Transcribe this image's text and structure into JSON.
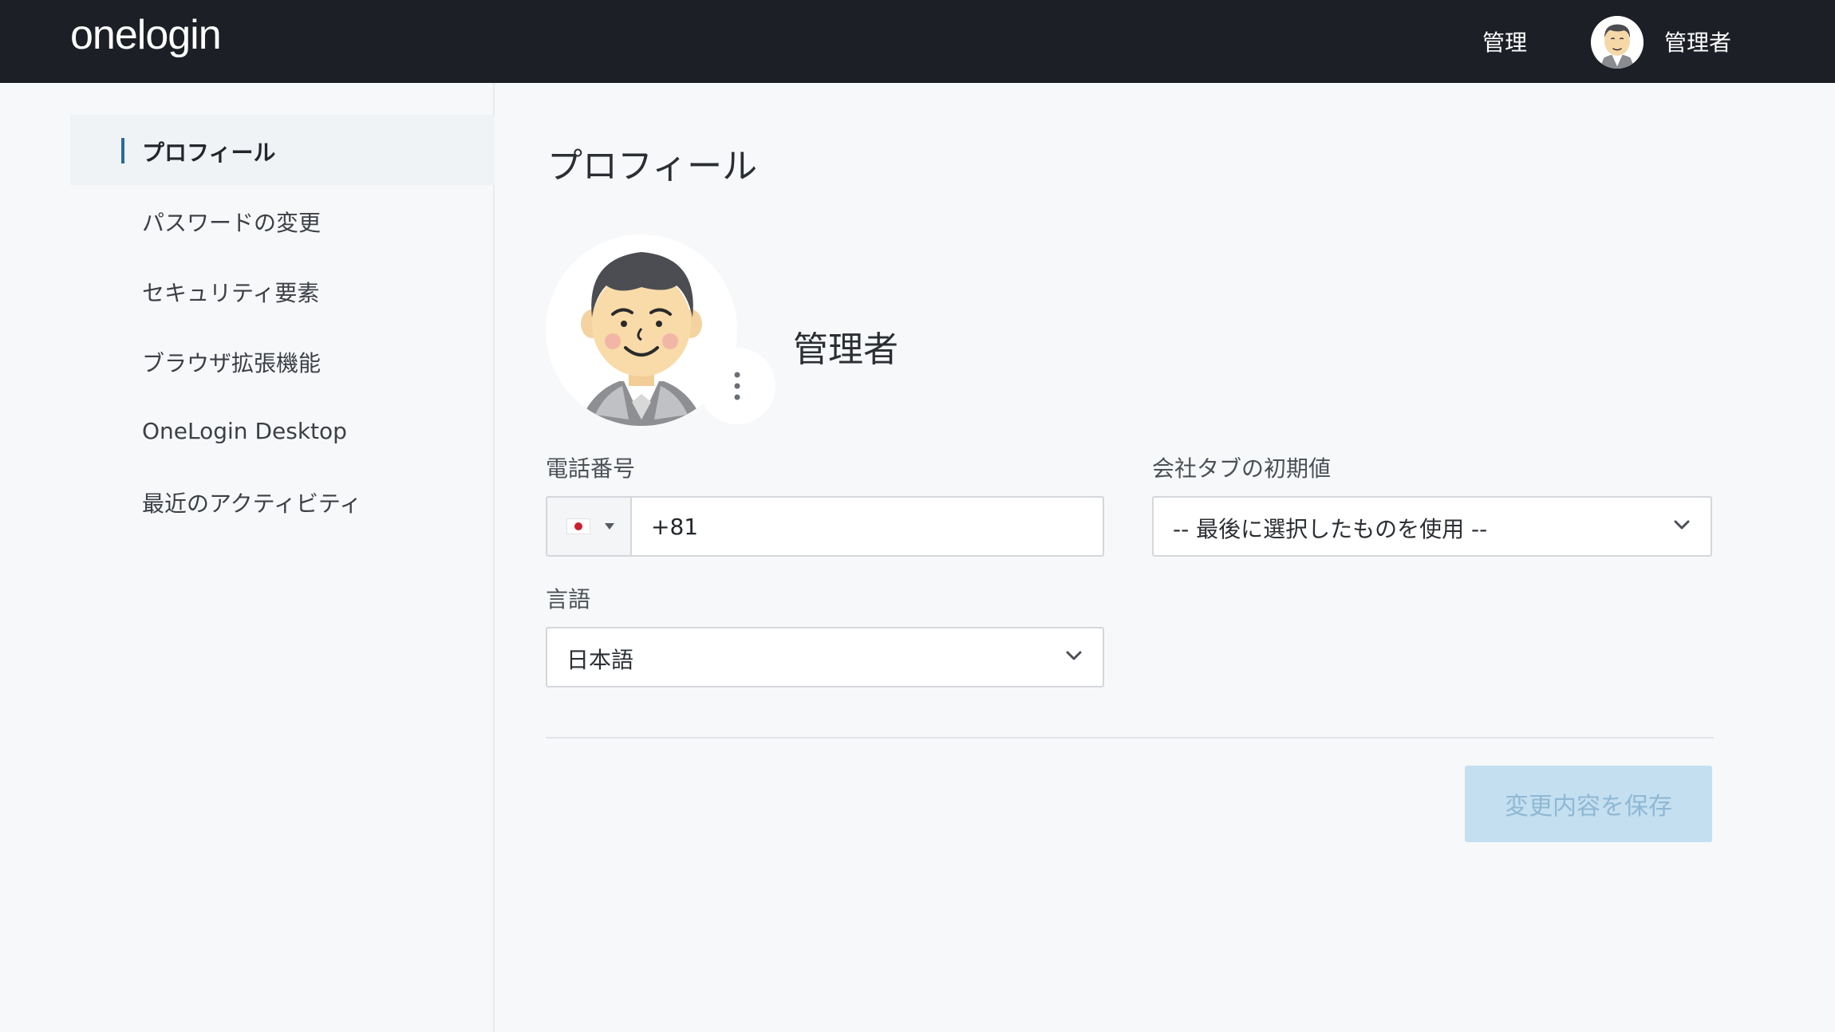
{
  "header": {
    "logo_text": "onelogin",
    "admin_link": "管理",
    "username": "管理者"
  },
  "sidebar": {
    "items": [
      {
        "label": "プロフィール",
        "active": true
      },
      {
        "label": "パスワードの変更",
        "active": false
      },
      {
        "label": "セキュリティ要素",
        "active": false
      },
      {
        "label": "ブラウザ拡張機能",
        "active": false
      },
      {
        "label": "OneLogin Desktop",
        "active": false
      },
      {
        "label": "最近のアクティビティ",
        "active": false
      }
    ]
  },
  "main": {
    "title": "プロフィール",
    "profile_name": "管理者",
    "phone": {
      "label": "電話番号",
      "value": "+81"
    },
    "company_tab": {
      "label": "会社タブの初期値",
      "value": "-- 最後に選択したものを使用 --"
    },
    "language": {
      "label": "言語",
      "value": "日本語"
    },
    "save_label": "変更内容を保存"
  },
  "colors": {
    "topbar": "#1c1f26",
    "accent": "#2d6b9a",
    "save_disabled_bg": "#c4dff0",
    "save_disabled_text": "#8fb8d4"
  }
}
